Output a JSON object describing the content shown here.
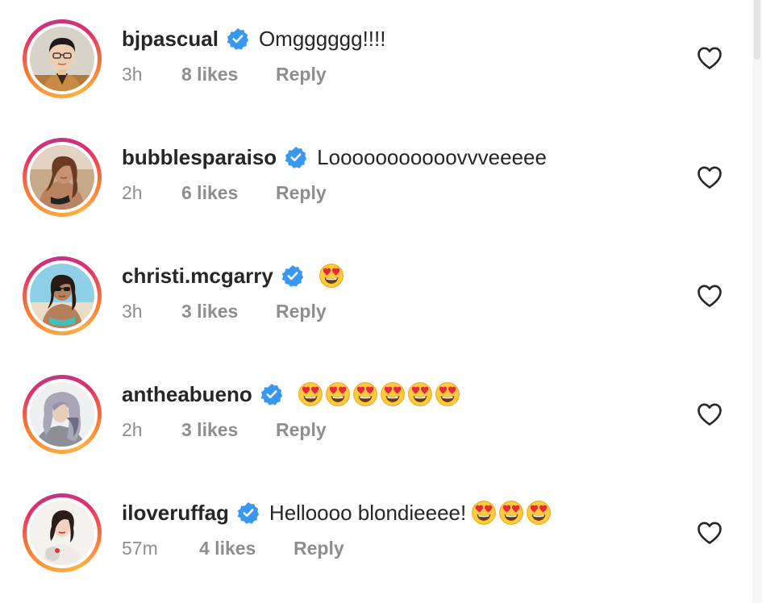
{
  "comments": [
    {
      "username": "bjpascual",
      "text": "Omgggggg!!!!",
      "emoji_count": 0,
      "time": "3h",
      "likes": "8 likes",
      "reply": "Reply",
      "avatar": "avatar-man-glasses"
    },
    {
      "username": "bubblesparaiso",
      "text": "Looooooooooovvveeeee",
      "emoji_count": 0,
      "time": "2h",
      "likes": "6 likes",
      "reply": "Reply",
      "avatar": "avatar-woman-beach"
    },
    {
      "username": "christi.mcgarry",
      "text": "",
      "emoji_count": 1,
      "time": "3h",
      "likes": "3 likes",
      "reply": "Reply",
      "avatar": "avatar-woman-beach-sunglasses"
    },
    {
      "username": "antheabueno",
      "text": "",
      "emoji_count": 6,
      "time": "2h",
      "likes": "3 likes",
      "reply": "Reply",
      "avatar": "avatar-woman-grey-hair"
    },
    {
      "username": "iloveruffag",
      "text": "Helloooo blondieeee!",
      "emoji_count": 3,
      "time": "57m",
      "likes": "4 likes",
      "reply": "Reply",
      "avatar": "avatar-woman-red-flower"
    }
  ],
  "icons": {
    "verified": "verified-badge-icon",
    "emoji": "heart-eyes-emoji-icon",
    "like": "heart-outline-icon"
  },
  "colors": {
    "verified_blue": "#3897f0",
    "meta_grey": "#8e8e8e",
    "text": "#262626",
    "story_ring_start": "#f9a03f",
    "story_ring_end": "#c13584"
  }
}
